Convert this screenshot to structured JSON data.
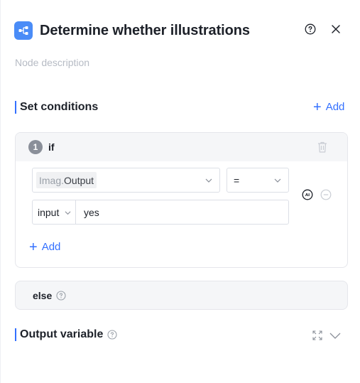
{
  "header": {
    "title": "Determine whether illustrations",
    "icon": "branch-node-icon",
    "accent_color": "#4a8cf7"
  },
  "description_placeholder": "Node description",
  "conditions_section": {
    "title": "Set conditions",
    "add_label": "Add"
  },
  "branch": {
    "index": "1",
    "keyword": "if",
    "condition": {
      "variable_prefix": "Imag.",
      "variable_name": "Output",
      "operator": "=",
      "value_type": "input",
      "value": "yes"
    },
    "add_label": "Add"
  },
  "else_branch": {
    "label": "else"
  },
  "output_section": {
    "title": "Output variable"
  },
  "colors": {
    "link": "#3370ff",
    "section_bar": "#3370ff"
  }
}
